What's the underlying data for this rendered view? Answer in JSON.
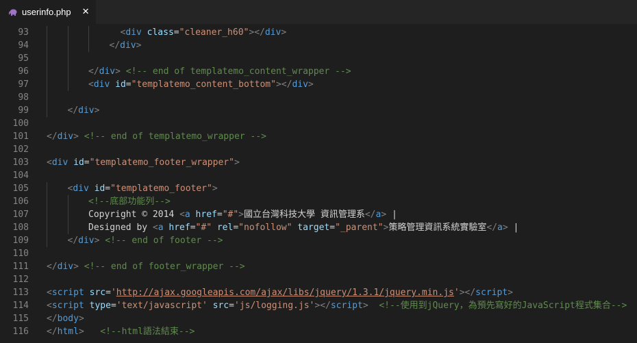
{
  "tab": {
    "title": "userinfo.php",
    "icon": "php-elephant-icon",
    "close_glyph": "✕",
    "icon_color": "#a074c4"
  },
  "colors": {
    "background": "#1e1e1e",
    "tag": "#569cd6",
    "attribute": "#9cdcfe",
    "string": "#ce9178",
    "comment": "#608b4e",
    "line_number": "#858585"
  },
  "lines": [
    {
      "n": "93",
      "indent": 3,
      "tokens": [
        [
          "punc",
          "<"
        ],
        [
          "tag",
          "div"
        ],
        [
          "txt",
          " "
        ],
        [
          "attr",
          "class"
        ],
        [
          "txt",
          "="
        ],
        [
          "str",
          "\"cleaner_h60\""
        ],
        [
          "punc",
          ">"
        ],
        [
          "punc",
          "</"
        ],
        [
          "tag",
          "div"
        ],
        [
          "punc",
          ">"
        ]
      ],
      "shift": 4
    },
    {
      "n": "94",
      "indent": 3,
      "tokens": [
        [
          "punc",
          "</"
        ],
        [
          "tag",
          "div"
        ],
        [
          "punc",
          ">"
        ]
      ]
    },
    {
      "n": "95",
      "indent": 2,
      "tokens": []
    },
    {
      "n": "96",
      "indent": 2,
      "tokens": [
        [
          "punc",
          "</"
        ],
        [
          "tag",
          "div"
        ],
        [
          "punc",
          ">"
        ],
        [
          "txt",
          " "
        ],
        [
          "com",
          "<!-- end of templatemo_content_wrapper -->"
        ]
      ]
    },
    {
      "n": "97",
      "indent": 2,
      "tokens": [
        [
          "punc",
          "<"
        ],
        [
          "tag",
          "div"
        ],
        [
          "txt",
          " "
        ],
        [
          "attr",
          "id"
        ],
        [
          "txt",
          "="
        ],
        [
          "str",
          "\"templatemo_content_bottom\""
        ],
        [
          "punc",
          ">"
        ],
        [
          "punc",
          "</"
        ],
        [
          "tag",
          "div"
        ],
        [
          "punc",
          ">"
        ]
      ]
    },
    {
      "n": "98",
      "indent": 1,
      "tokens": []
    },
    {
      "n": "99",
      "indent": 1,
      "tokens": [
        [
          "punc",
          "</"
        ],
        [
          "tag",
          "div"
        ],
        [
          "punc",
          ">"
        ]
      ]
    },
    {
      "n": "100",
      "indent": 0,
      "tokens": []
    },
    {
      "n": "101",
      "indent": 0,
      "tokens": [
        [
          "punc",
          "</"
        ],
        [
          "tag",
          "div"
        ],
        [
          "punc",
          ">"
        ],
        [
          "txt",
          " "
        ],
        [
          "com",
          "<!-- end of templatemo_wrapper -->"
        ]
      ]
    },
    {
      "n": "102",
      "indent": 0,
      "tokens": []
    },
    {
      "n": "103",
      "indent": 0,
      "tokens": [
        [
          "punc",
          "<"
        ],
        [
          "tag",
          "div"
        ],
        [
          "txt",
          " "
        ],
        [
          "attr",
          "id"
        ],
        [
          "txt",
          "="
        ],
        [
          "str",
          "\"templatemo_footer_wrapper\""
        ],
        [
          "punc",
          ">"
        ]
      ]
    },
    {
      "n": "104",
      "indent": 0,
      "tokens": []
    },
    {
      "n": "105",
      "indent": 1,
      "tokens": [
        [
          "punc",
          "<"
        ],
        [
          "tag",
          "div"
        ],
        [
          "txt",
          " "
        ],
        [
          "attr",
          "id"
        ],
        [
          "txt",
          "="
        ],
        [
          "str",
          "\"templatemo_footer\""
        ],
        [
          "punc",
          ">"
        ]
      ]
    },
    {
      "n": "106",
      "indent": 2,
      "tokens": [
        [
          "com",
          "<!--底部功能列-->"
        ]
      ]
    },
    {
      "n": "107",
      "indent": 2,
      "tokens": [
        [
          "txt",
          "Copyright © 2014 "
        ],
        [
          "punc",
          "<"
        ],
        [
          "tag",
          "a"
        ],
        [
          "txt",
          " "
        ],
        [
          "attr",
          "href"
        ],
        [
          "txt",
          "="
        ],
        [
          "str",
          "\"#\""
        ],
        [
          "punc",
          ">"
        ],
        [
          "txt",
          "國立台灣科技大學 資訊管理系"
        ],
        [
          "punc",
          "</"
        ],
        [
          "tag",
          "a"
        ],
        [
          "punc",
          ">"
        ],
        [
          "txt",
          " |"
        ]
      ]
    },
    {
      "n": "108",
      "indent": 2,
      "tokens": [
        [
          "txt",
          "Designed by "
        ],
        [
          "punc",
          "<"
        ],
        [
          "tag",
          "a"
        ],
        [
          "txt",
          " "
        ],
        [
          "attr",
          "href"
        ],
        [
          "txt",
          "="
        ],
        [
          "str",
          "\"#\""
        ],
        [
          "txt",
          " "
        ],
        [
          "attr",
          "rel"
        ],
        [
          "txt",
          "="
        ],
        [
          "str",
          "\"nofollow\""
        ],
        [
          "txt",
          " "
        ],
        [
          "attr",
          "target"
        ],
        [
          "txt",
          "="
        ],
        [
          "str",
          "\"_parent\""
        ],
        [
          "punc",
          ">"
        ],
        [
          "txt",
          "策略管理資訊系統實驗室"
        ],
        [
          "punc",
          "</"
        ],
        [
          "tag",
          "a"
        ],
        [
          "punc",
          ">"
        ],
        [
          "txt",
          " |"
        ]
      ]
    },
    {
      "n": "109",
      "indent": 1,
      "tokens": [
        [
          "punc",
          "</"
        ],
        [
          "tag",
          "div"
        ],
        [
          "punc",
          ">"
        ],
        [
          "txt",
          " "
        ],
        [
          "com",
          "<!-- end of footer -->"
        ]
      ]
    },
    {
      "n": "110",
      "indent": 0,
      "tokens": []
    },
    {
      "n": "111",
      "indent": 0,
      "tokens": [
        [
          "punc",
          "</"
        ],
        [
          "tag",
          "div"
        ],
        [
          "punc",
          ">"
        ],
        [
          "txt",
          " "
        ],
        [
          "com",
          "<!-- end of footer_wrapper -->"
        ]
      ]
    },
    {
      "n": "112",
      "indent": 0,
      "tokens": []
    },
    {
      "n": "113",
      "indent": 0,
      "tokens": [
        [
          "punc",
          "<"
        ],
        [
          "tag",
          "script"
        ],
        [
          "txt",
          " "
        ],
        [
          "attr",
          "src"
        ],
        [
          "txt",
          "="
        ],
        [
          "str",
          "'"
        ],
        [
          "link",
          "http://ajax.googleapis.com/ajax/libs/jquery/1.3.1/jquery.min.js"
        ],
        [
          "str",
          "'"
        ],
        [
          "punc",
          ">"
        ],
        [
          "punc",
          "</"
        ],
        [
          "tag",
          "script"
        ],
        [
          "punc",
          ">"
        ]
      ]
    },
    {
      "n": "114",
      "indent": 0,
      "tokens": [
        [
          "punc",
          "<"
        ],
        [
          "tag",
          "script"
        ],
        [
          "txt",
          " "
        ],
        [
          "attr",
          "type"
        ],
        [
          "txt",
          "="
        ],
        [
          "str",
          "'text/javascript'"
        ],
        [
          "txt",
          " "
        ],
        [
          "attr",
          "src"
        ],
        [
          "txt",
          "="
        ],
        [
          "str",
          "'js/logging.js'"
        ],
        [
          "punc",
          ">"
        ],
        [
          "punc",
          "</"
        ],
        [
          "tag",
          "script"
        ],
        [
          "punc",
          ">"
        ],
        [
          "txt",
          "  "
        ],
        [
          "com",
          "<!--使用到jQuery，為預先寫好的JavaScript程式集合-->"
        ]
      ]
    },
    {
      "n": "115",
      "indent": 0,
      "tokens": [
        [
          "punc",
          "</"
        ],
        [
          "tag",
          "body"
        ],
        [
          "punc",
          ">"
        ]
      ]
    },
    {
      "n": "116",
      "indent": 0,
      "tokens": [
        [
          "punc",
          "</"
        ],
        [
          "tag",
          "html"
        ],
        [
          "punc",
          ">"
        ],
        [
          "txt",
          "   "
        ],
        [
          "com",
          "<!--html語法結束-->"
        ]
      ]
    }
  ]
}
